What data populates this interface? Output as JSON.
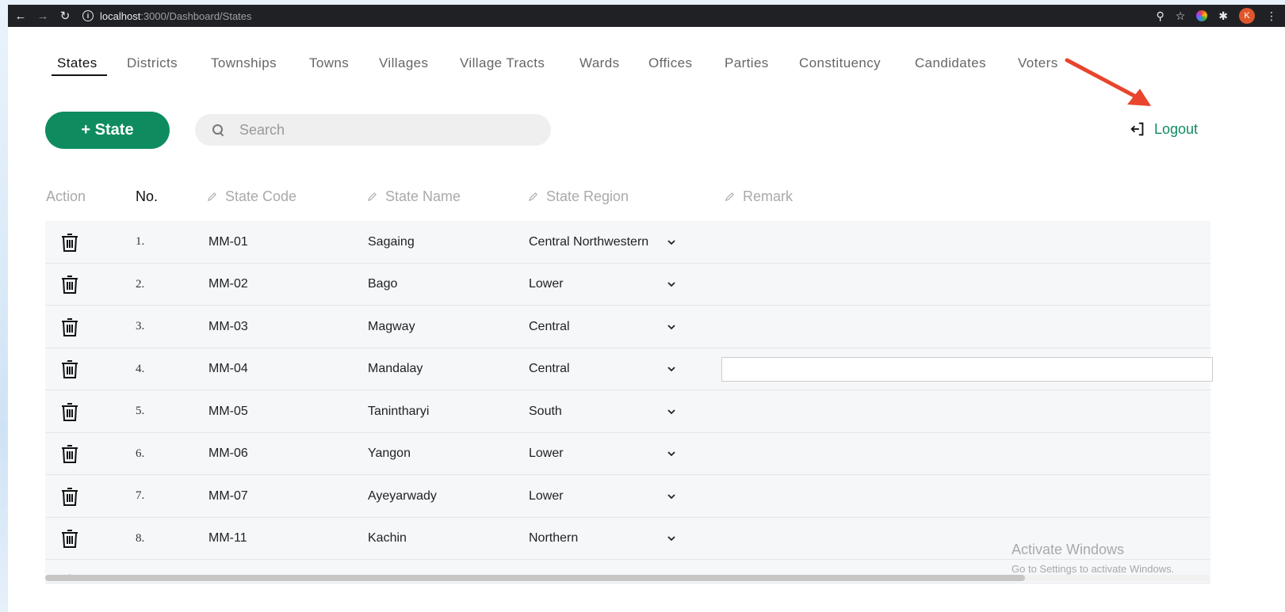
{
  "browser": {
    "url_host": "localhost",
    "url_path": ":3000/Dashboard/States",
    "profile_initial": "K"
  },
  "tabs": [
    {
      "label": "States",
      "active": true
    },
    {
      "label": "Districts"
    },
    {
      "label": "Townships"
    },
    {
      "label": "Towns"
    },
    {
      "label": "Villages"
    },
    {
      "label": "Village Tracts"
    },
    {
      "label": "Wards"
    },
    {
      "label": "Offices"
    },
    {
      "label": "Parties"
    },
    {
      "label": "Constituency"
    },
    {
      "label": "Candidates"
    },
    {
      "label": "Voters"
    }
  ],
  "toolbar": {
    "add_label": "+ State",
    "search_placeholder": "Search",
    "logout_label": "Logout"
  },
  "table": {
    "headers": {
      "action": "Action",
      "no": "No.",
      "state_code": "State Code",
      "state_name": "State Name",
      "state_region": "State Region",
      "remark": "Remark"
    },
    "rows": [
      {
        "no": "1.",
        "code": "MM-01",
        "name": "Sagaing",
        "region": "Central Northwestern"
      },
      {
        "no": "2.",
        "code": "MM-02",
        "name": "Bago",
        "region": "Lower"
      },
      {
        "no": "3.",
        "code": "MM-03",
        "name": "Magway",
        "region": "Central"
      },
      {
        "no": "4.",
        "code": "MM-04",
        "name": "Mandalay",
        "region": "Central"
      },
      {
        "no": "5.",
        "code": "MM-05",
        "name": "Tanintharyi",
        "region": "South"
      },
      {
        "no": "6.",
        "code": "MM-06",
        "name": "Yangon",
        "region": "Lower"
      },
      {
        "no": "7.",
        "code": "MM-07",
        "name": "Ayeyarwady",
        "region": "Lower"
      },
      {
        "no": "8.",
        "code": "MM-11",
        "name": "Kachin",
        "region": "Northern"
      }
    ]
  },
  "watermark": {
    "title": "Activate Windows",
    "subtitle": "Go to Settings to activate Windows."
  },
  "colors": {
    "accent": "#0f8c5f",
    "annotation_arrow": "#e8452c"
  }
}
